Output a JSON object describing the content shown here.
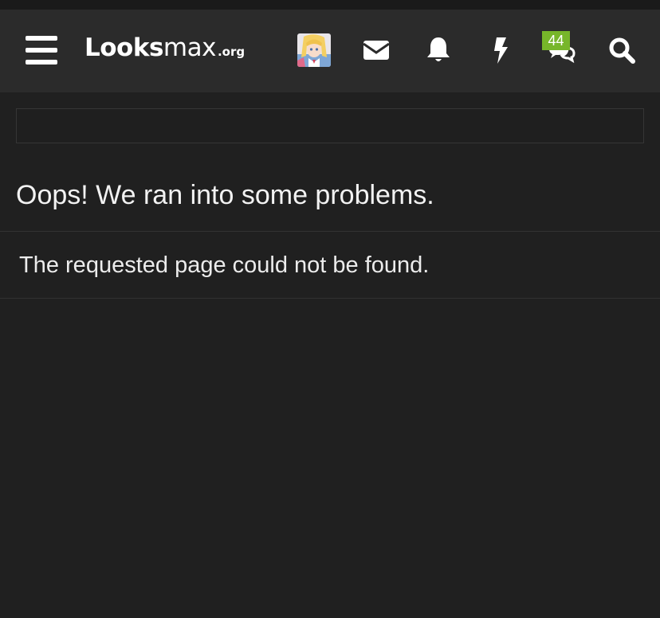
{
  "header": {
    "logo": {
      "main": "Looks",
      "sub": "max",
      "tld": ".org"
    },
    "icons": {
      "menu": "menu-hamburger-icon",
      "avatar": "user-avatar",
      "inbox": "envelope-icon",
      "alerts": "bell-icon",
      "whats_new": "bolt-icon",
      "conversations": "comments-icon",
      "search": "search-icon"
    },
    "conversation_badge": "44"
  },
  "page": {
    "title": "Oops! We ran into some problems.",
    "error_message": "The requested page could not be found."
  },
  "colors": {
    "background": "#202020",
    "header_bg": "#2b2b2b",
    "badge_green": "#77b62a",
    "text": "#ececec"
  }
}
